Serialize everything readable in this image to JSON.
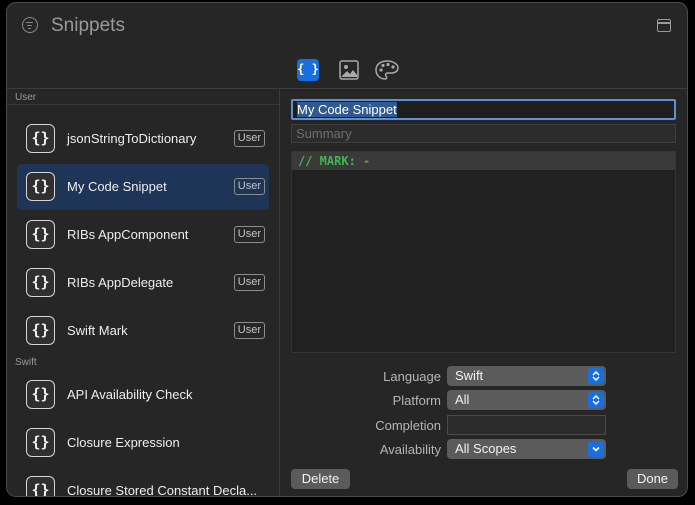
{
  "window": {
    "title": "Snippets"
  },
  "tabs": [
    {
      "name": "code-snippets",
      "icon": "curly-braces-icon",
      "label": "{ }",
      "selected": true
    },
    {
      "name": "media",
      "icon": "image-icon",
      "selected": false
    },
    {
      "name": "colors",
      "icon": "palette-icon",
      "selected": false
    }
  ],
  "sidebar": {
    "sections": [
      {
        "label": "User"
      },
      {
        "label": "Swift"
      }
    ],
    "icon_glyph": "{}",
    "items": [
      {
        "label": "jsonStringToDictionary",
        "badge": "User",
        "selected": false
      },
      {
        "label": "My Code Snippet",
        "badge": "User",
        "selected": true
      },
      {
        "label": "RIBs AppComponent",
        "badge": "User",
        "selected": false
      },
      {
        "label": "RIBs AppDelegate",
        "badge": "User",
        "selected": false
      },
      {
        "label": "Swift Mark",
        "badge": "User",
        "selected": false
      },
      {
        "label": "API Availability Check",
        "selected": false
      },
      {
        "label": "Closure Expression",
        "selected": false
      },
      {
        "label": "Closure Stored Constant Decla...",
        "selected": false
      }
    ]
  },
  "editor": {
    "title_value": "My Code Snippet",
    "summary_placeholder": "Summary",
    "code": "// MARK: -"
  },
  "properties": {
    "language_label": "Language",
    "language_value": "Swift",
    "platform_label": "Platform",
    "platform_value": "All",
    "completion_label": "Completion",
    "completion_value": "",
    "availability_label": "Availability",
    "availability_value": "All Scopes"
  },
  "buttons": {
    "delete_label": "Delete",
    "done_label": "Done"
  },
  "colors": {
    "accent": "#1a6fe0",
    "selection": "#1e3557",
    "code_comment": "#3fb653"
  }
}
